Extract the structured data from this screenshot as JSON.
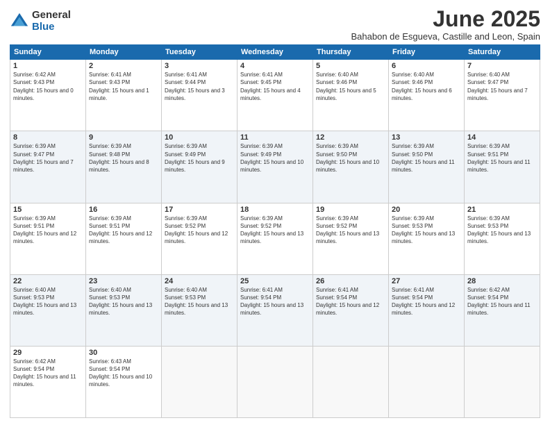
{
  "logo": {
    "general": "General",
    "blue": "Blue"
  },
  "title": "June 2025",
  "location": "Bahabon de Esgueva, Castille and Leon, Spain",
  "headers": [
    "Sunday",
    "Monday",
    "Tuesday",
    "Wednesday",
    "Thursday",
    "Friday",
    "Saturday"
  ],
  "weeks": [
    [
      {
        "day": "1",
        "sunrise": "6:42 AM",
        "sunset": "9:43 PM",
        "daylight": "15 hours and 0 minutes."
      },
      {
        "day": "2",
        "sunrise": "6:41 AM",
        "sunset": "9:43 PM",
        "daylight": "15 hours and 1 minute."
      },
      {
        "day": "3",
        "sunrise": "6:41 AM",
        "sunset": "9:44 PM",
        "daylight": "15 hours and 3 minutes."
      },
      {
        "day": "4",
        "sunrise": "6:41 AM",
        "sunset": "9:45 PM",
        "daylight": "15 hours and 4 minutes."
      },
      {
        "day": "5",
        "sunrise": "6:40 AM",
        "sunset": "9:46 PM",
        "daylight": "15 hours and 5 minutes."
      },
      {
        "day": "6",
        "sunrise": "6:40 AM",
        "sunset": "9:46 PM",
        "daylight": "15 hours and 6 minutes."
      },
      {
        "day": "7",
        "sunrise": "6:40 AM",
        "sunset": "9:47 PM",
        "daylight": "15 hours and 7 minutes."
      }
    ],
    [
      {
        "day": "8",
        "sunrise": "6:39 AM",
        "sunset": "9:47 PM",
        "daylight": "15 hours and 7 minutes."
      },
      {
        "day": "9",
        "sunrise": "6:39 AM",
        "sunset": "9:48 PM",
        "daylight": "15 hours and 8 minutes."
      },
      {
        "day": "10",
        "sunrise": "6:39 AM",
        "sunset": "9:49 PM",
        "daylight": "15 hours and 9 minutes."
      },
      {
        "day": "11",
        "sunrise": "6:39 AM",
        "sunset": "9:49 PM",
        "daylight": "15 hours and 10 minutes."
      },
      {
        "day": "12",
        "sunrise": "6:39 AM",
        "sunset": "9:50 PM",
        "daylight": "15 hours and 10 minutes."
      },
      {
        "day": "13",
        "sunrise": "6:39 AM",
        "sunset": "9:50 PM",
        "daylight": "15 hours and 11 minutes."
      },
      {
        "day": "14",
        "sunrise": "6:39 AM",
        "sunset": "9:51 PM",
        "daylight": "15 hours and 11 minutes."
      }
    ],
    [
      {
        "day": "15",
        "sunrise": "6:39 AM",
        "sunset": "9:51 PM",
        "daylight": "15 hours and 12 minutes."
      },
      {
        "day": "16",
        "sunrise": "6:39 AM",
        "sunset": "9:51 PM",
        "daylight": "15 hours and 12 minutes."
      },
      {
        "day": "17",
        "sunrise": "6:39 AM",
        "sunset": "9:52 PM",
        "daylight": "15 hours and 12 minutes."
      },
      {
        "day": "18",
        "sunrise": "6:39 AM",
        "sunset": "9:52 PM",
        "daylight": "15 hours and 13 minutes."
      },
      {
        "day": "19",
        "sunrise": "6:39 AM",
        "sunset": "9:52 PM",
        "daylight": "15 hours and 13 minutes."
      },
      {
        "day": "20",
        "sunrise": "6:39 AM",
        "sunset": "9:53 PM",
        "daylight": "15 hours and 13 minutes."
      },
      {
        "day": "21",
        "sunrise": "6:39 AM",
        "sunset": "9:53 PM",
        "daylight": "15 hours and 13 minutes."
      }
    ],
    [
      {
        "day": "22",
        "sunrise": "6:40 AM",
        "sunset": "9:53 PM",
        "daylight": "15 hours and 13 minutes."
      },
      {
        "day": "23",
        "sunrise": "6:40 AM",
        "sunset": "9:53 PM",
        "daylight": "15 hours and 13 minutes."
      },
      {
        "day": "24",
        "sunrise": "6:40 AM",
        "sunset": "9:53 PM",
        "daylight": "15 hours and 13 minutes."
      },
      {
        "day": "25",
        "sunrise": "6:41 AM",
        "sunset": "9:54 PM",
        "daylight": "15 hours and 13 minutes."
      },
      {
        "day": "26",
        "sunrise": "6:41 AM",
        "sunset": "9:54 PM",
        "daylight": "15 hours and 12 minutes."
      },
      {
        "day": "27",
        "sunrise": "6:41 AM",
        "sunset": "9:54 PM",
        "daylight": "15 hours and 12 minutes."
      },
      {
        "day": "28",
        "sunrise": "6:42 AM",
        "sunset": "9:54 PM",
        "daylight": "15 hours and 11 minutes."
      }
    ],
    [
      {
        "day": "29",
        "sunrise": "6:42 AM",
        "sunset": "9:54 PM",
        "daylight": "15 hours and 11 minutes."
      },
      {
        "day": "30",
        "sunrise": "6:43 AM",
        "sunset": "9:54 PM",
        "daylight": "15 hours and 10 minutes."
      },
      null,
      null,
      null,
      null,
      null
    ]
  ]
}
